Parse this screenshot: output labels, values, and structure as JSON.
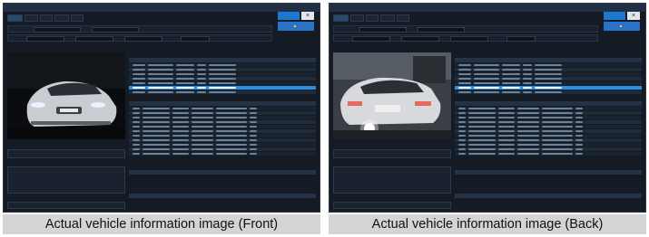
{
  "captions": {
    "front": "Actual vehicle information image (Front)",
    "back": "Actual vehicle information image (Back)"
  },
  "colors": {
    "app_background": "#151b24",
    "selected_row": "#2a8fe6",
    "alarm_button": "#2a72c8",
    "caption_background": "#d4d4d4"
  },
  "icons": [
    "close-icon",
    "warning-icon"
  ]
}
